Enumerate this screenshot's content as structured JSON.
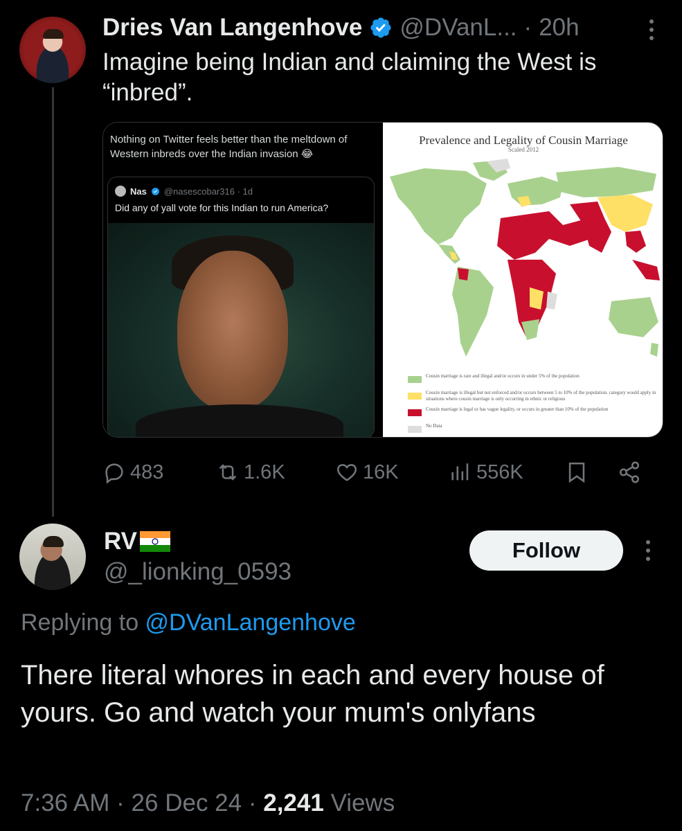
{
  "parent_tweet": {
    "author_name": "Dries Van Langenhove",
    "author_handle": "@DVanL...",
    "separator": "·",
    "time": "20h",
    "text": "Imagine being Indian and claiming the West is “inbred”.",
    "media": {
      "left": {
        "caption": "Nothing on Twitter feels better than the meltdown of Western inbreds over the Indian invasion 😂",
        "quote": {
          "name": "Nas",
          "handle": "@nasescobar316 · 1d",
          "text": "Did any of yall vote for this Indian to run America?"
        }
      },
      "right": {
        "title": "Prevalence and Legality of Cousin Marriage",
        "subtitle": "Scaled 2012",
        "legend": [
          {
            "color": "#a9d18e",
            "text": "Cousin marriage is rare and illegal and/or occurs in under 5% of the population"
          },
          {
            "color": "#ffe066",
            "text": "Cousin marriage is illegal but not enforced and/or occurs between 5 to 10% of the population. category would apply in situations where cousin marriage is only occurring in ethnic or religious"
          },
          {
            "color": "#c8102e",
            "text": "Cousin marriage is legal or has vague legality, or occurs in greater than 10% of the population"
          },
          {
            "color": "#dddddd",
            "text": "No Data"
          }
        ]
      }
    },
    "actions": {
      "replies": "483",
      "reposts": "1.6K",
      "likes": "16K",
      "views": "556K"
    }
  },
  "reply": {
    "author_name": "RV",
    "author_handle": "@_lionking_0593",
    "follow_label": "Follow",
    "replying_to_prefix": "Replying to ",
    "replying_to_handle": "@DVanLangenhove",
    "text": "There literal whores in each and every house of yours. Go and watch your mum's onlyfans",
    "time": "7:36 AM",
    "separator": "·",
    "date": "26 Dec 24",
    "views_count": "2,241",
    "views_label": "Views"
  },
  "colors": {
    "background": "#000000",
    "text_primary": "#e7e9ea",
    "text_secondary": "#71767b",
    "link": "#1d9bf0",
    "verified": "#1d9bf0"
  }
}
